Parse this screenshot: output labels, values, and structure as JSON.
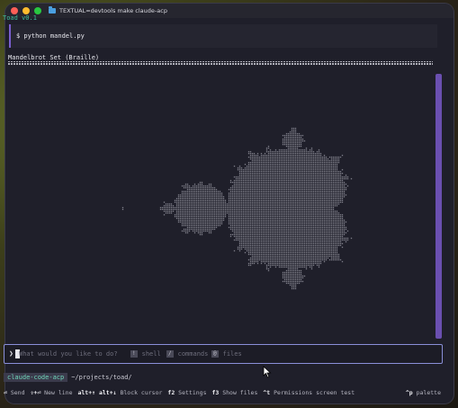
{
  "window": {
    "title": "TEXTUAL=devtools make claude-acp"
  },
  "app": {
    "name_version": "Toad v0.1"
  },
  "command_block": {
    "command": "$ python mandel.py"
  },
  "output": {
    "title": "Mandelbrot Set (Braille)",
    "rule_char": "="
  },
  "input": {
    "prompt": "❯",
    "placeholder": "What would you like to do?",
    "hints": [
      {
        "key": "!",
        "label": "shell"
      },
      {
        "key": "/",
        "label": "commands"
      },
      {
        "key": "@",
        "label": "files"
      }
    ]
  },
  "status": {
    "agent": "claude-code-acp",
    "path": "~/projects/toad/"
  },
  "footer": {
    "items": [
      {
        "key": "⏎",
        "label": "Send"
      },
      {
        "key": "⇧+⏎",
        "label": "New line"
      },
      {
        "key": "alt+↑ alt+↓",
        "label": "Block cursor"
      },
      {
        "key": "f2",
        "label": "Settings"
      },
      {
        "key": "f3",
        "label": "Show files"
      },
      {
        "key": "^t",
        "label": "Permissions screen test"
      }
    ],
    "palette": {
      "key": "^p",
      "label": "palette"
    }
  },
  "colors": {
    "accent_purple": "#7a5fd0",
    "accent_teal": "#3fbf9a",
    "fractal": "#c9c9d2"
  }
}
